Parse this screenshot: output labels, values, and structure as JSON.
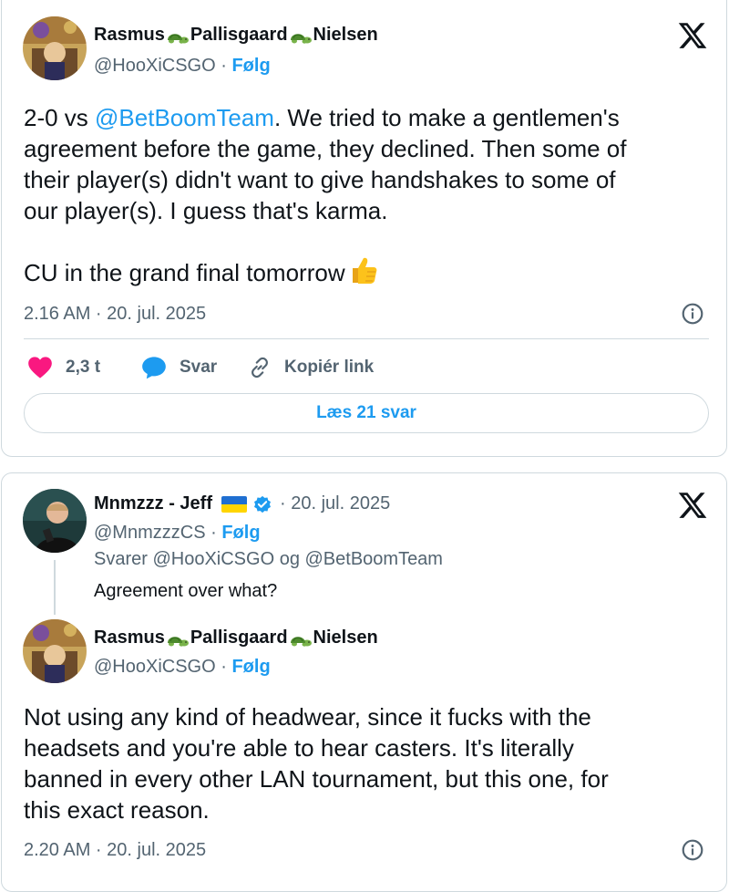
{
  "tweet1": {
    "author_name_parts": [
      "Rasmus",
      "Pallisgaard",
      "Nielsen"
    ],
    "handle": "@HooXiCSGO",
    "separator": "·",
    "follow_label": "Følg",
    "body_lines": {
      "line1_prefix": "2-0 vs ",
      "mention": "@BetBoomTeam",
      "line1_suffix": ". We tried to make a gentlemen's",
      "line2": "agreement before the game, they declined. Then some of",
      "line3": "their player(s) didn't want to give handshakes to some of",
      "line4": "our player(s). I guess that's karma.",
      "line5": "CU in the grand final tomorrow"
    },
    "timestamp": "2.16 AM · 20. jul. 2025",
    "likes": "2,3 t",
    "reply_label": "Svar",
    "copy_link_label": "Kopiér link",
    "read_replies_label": "Læs 21 svar"
  },
  "tweet2": {
    "author_name": "Mnmzzz - Jeff",
    "date": "· 20. jul. 2025",
    "handle": "@MnmzzzCS",
    "separator": "·",
    "follow_label": "Følg",
    "replying_to": "Svarer @HooXiCSGO og @BetBoomTeam",
    "text": "Agreement over what?"
  },
  "tweet3": {
    "author_name_parts": [
      "Rasmus",
      "Pallisgaard",
      "Nielsen"
    ],
    "handle": "@HooXiCSGO",
    "separator": "·",
    "follow_label": "Følg",
    "body_lines": {
      "line1": "Not using any kind of headwear, since it fucks with the",
      "line2": "headsets and you're able to hear casters. It's literally",
      "line3": "banned in every other LAN tournament, but this one, for",
      "line4": "this exact reason."
    },
    "timestamp": "2.20 AM · 20. jul. 2025"
  },
  "colors": {
    "accent": "#1d9bf0",
    "like": "#f91880",
    "muted": "#536471",
    "border": "#cfd9de"
  },
  "icons": [
    "x-logo-icon",
    "turtle-emoji-icon",
    "thumbs-up-emoji-icon",
    "info-icon",
    "heart-icon",
    "speech-bubble-icon",
    "link-icon",
    "ukraine-flag-icon",
    "verified-badge-icon"
  ]
}
